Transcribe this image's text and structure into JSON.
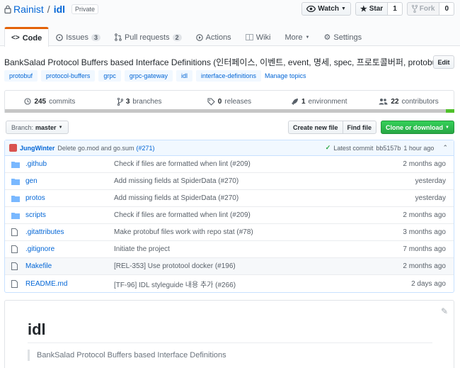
{
  "repo": {
    "owner": "Rainist",
    "separator": "/",
    "name": "idl",
    "visibility": "Private"
  },
  "actions": {
    "watch_label": "Watch",
    "watch_count": "",
    "star_label": "Star",
    "star_count": "1",
    "fork_label": "Fork",
    "fork_count": "0"
  },
  "tabs": [
    {
      "label": "Code",
      "icon": "code-icon"
    },
    {
      "label": "Issues",
      "count": "3",
      "icon": "issue-icon"
    },
    {
      "label": "Pull requests",
      "count": "2",
      "icon": "pull-request-icon"
    },
    {
      "label": "Actions",
      "icon": "play-icon"
    },
    {
      "label": "Wiki",
      "icon": "book-icon"
    },
    {
      "label": "More",
      "icon": "chevron-down-icon"
    },
    {
      "label": "Settings",
      "icon": "gear-icon"
    }
  ],
  "description": "BankSalad Protocol Buffers based Interface Definitions (인터페이스, 이벤트, event, 명세, spec, 프로토콜버퍼, protobuf)",
  "edit_label": "Edit",
  "topics": [
    "protobuf",
    "protocol-buffers",
    "grpc",
    "grpc-gateway",
    "idl",
    "interface-definitions"
  ],
  "manage_topics": "Manage topics",
  "summary": {
    "commits_count": "245",
    "commits_label": "commits",
    "branches_count": "3",
    "branches_label": "branches",
    "releases_count": "0",
    "releases_label": "releases",
    "env_count": "1",
    "env_label": "environment",
    "contributors_count": "22",
    "contributors_label": "contributors"
  },
  "branch": {
    "prefix": "Branch:",
    "name": "master"
  },
  "file_actions": {
    "create": "Create new file",
    "find": "Find file",
    "clone": "Clone or download"
  },
  "latest_commit": {
    "author": "JungWinter",
    "message": "Delete go.mod and go.sum",
    "pr": "(#271)",
    "label": "Latest commit",
    "sha": "bb5157b",
    "age": "1 hour ago"
  },
  "files": [
    {
      "name": ".github",
      "type": "dir",
      "message": "Check if files are formatted when lint (#209)",
      "age": "2 months ago"
    },
    {
      "name": "gen",
      "type": "dir",
      "message": "Add missing fields at SpiderData (#270)",
      "age": "yesterday"
    },
    {
      "name": "protos",
      "type": "dir",
      "message": "Add missing fields at SpiderData (#270)",
      "age": "yesterday"
    },
    {
      "name": "scripts",
      "type": "dir",
      "message": "Check if files are formatted when lint (#209)",
      "age": "2 months ago"
    },
    {
      "name": ".gitattributes",
      "type": "file",
      "message": "Make protobuf files work with repo stat (#78)",
      "age": "3 months ago"
    },
    {
      "name": ".gitignore",
      "type": "file",
      "message": "Initiate the project",
      "age": "7 months ago"
    },
    {
      "name": "Makefile",
      "type": "file",
      "message": "[REL-353] Use prototool docker (#196)",
      "age": "2 months ago"
    },
    {
      "name": "README.md",
      "type": "file",
      "message": "[TF-96] IDL styleguide 내용 추가 (#266)",
      "age": "2 days ago"
    }
  ],
  "readme": {
    "title": "idl",
    "quote": "BankSalad Protocol Buffers based Interface Definitions"
  },
  "colors": {
    "link": "#0366d6",
    "accent_tab": "#e36209",
    "clone_green": "#28a745"
  }
}
